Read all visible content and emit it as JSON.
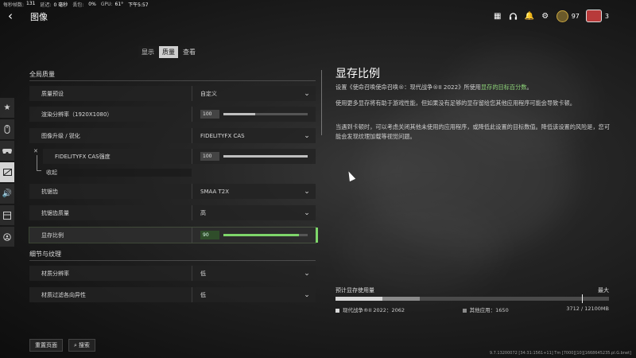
{
  "perf": {
    "fps_label": "每秒帧数:",
    "fps_value": "131",
    "latency_label": "延迟:",
    "latency_value": "0 毫秒",
    "loss_label": "丢包:",
    "cpu_value": "0%",
    "gpu_label": "GPU:",
    "gpu_value": "61°",
    "time": "下午5:57"
  },
  "header": {
    "title": "图像",
    "cp_count": "97",
    "party_count": "3"
  },
  "tabs": [
    "显示",
    "质量",
    "查看"
  ],
  "active_tab": "质量",
  "sections": {
    "global": "全局质量",
    "detail": "细节与纹理"
  },
  "settings": [
    {
      "label": "质量预设",
      "value": "自定义"
    },
    {
      "label": "渲染分辨率（1920X1080）",
      "value": "100",
      "level": 0.38
    },
    {
      "label": "图像升级 / 锐化",
      "value": "FIDELITYFX CAS"
    },
    {
      "label": "FIDELITYFX CAS强度",
      "value": "100",
      "level": 1.0
    },
    {
      "label": "抗锯齿",
      "value": "SMAA T2X"
    },
    {
      "label": "抗锯齿质量",
      "value": "高"
    },
    {
      "label": "显存比例",
      "value": "90",
      "level": 0.9
    },
    {
      "label": "材质分辨率",
      "value": "低"
    },
    {
      "label": "材质过滤各向异性",
      "value": "低"
    }
  ],
  "collapse_label": "收起",
  "buttons": {
    "reset": "重置页面",
    "search": "搜索"
  },
  "info": {
    "title": "显存比例",
    "p1_a": "设置《使命召唤使命召唤®：现代战争®II 2022》所使用",
    "p1_b": "显存的目标百分数",
    "p1_c": "。",
    "p2": "使用更多显存将有助于游戏性能，但如果没有足够的显存留给您其他应用程序可能会导致卡顿。",
    "p3": "当遇到卡顿时，可以考虑关闭其他未使用的应用程序，或降低此设置的目标数值。降低该设置的风险是，您可能会发现纹理加载等视觉问题。"
  },
  "vram": {
    "title": "预计显存使用量",
    "max_label": "最大",
    "game_label": "现代战争®II 2022：2062",
    "other_label": "其他应用：1650",
    "total": "3712 / 12100MB",
    "game_mb": 2062,
    "other_mb": 1650,
    "total_mb": 12100,
    "max_fraction": 0.9
  },
  "version": "9.7.13200072 [34:31:1561+11] Tm [7000][10][1668645235.pl.G.bnet]",
  "colors": {
    "accent": "#7ed66a"
  }
}
